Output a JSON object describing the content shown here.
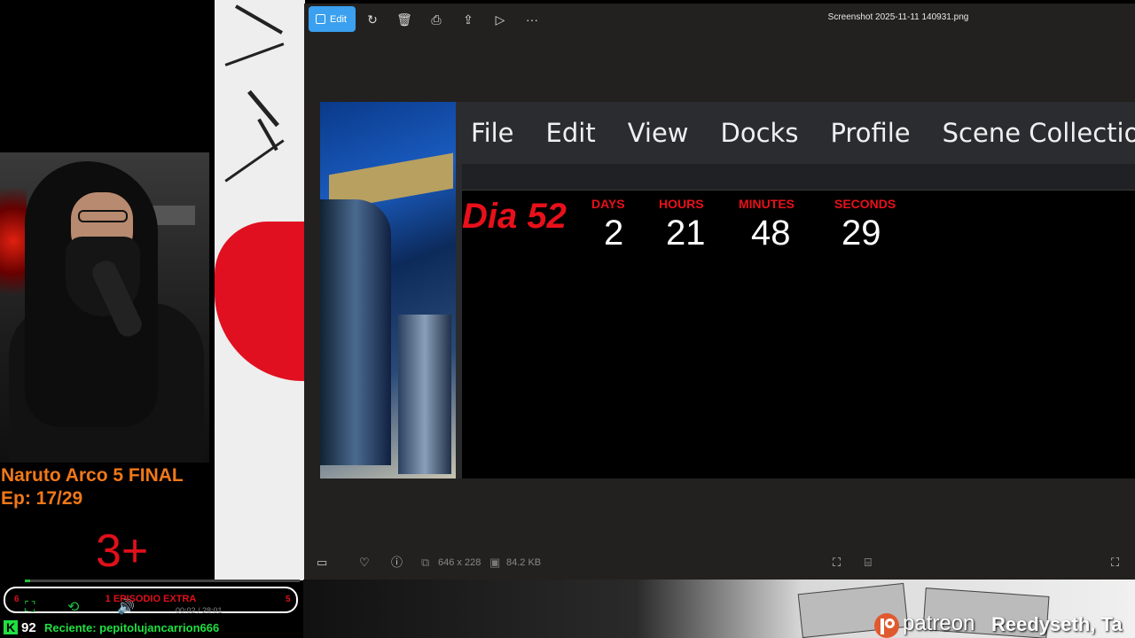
{
  "viewer": {
    "toolbar": {
      "edit_label": "Edit",
      "icons": [
        "edit-icon",
        "rotate-icon",
        "delete-icon",
        "print-icon",
        "share-icon",
        "slideshow-icon",
        "more-icon"
      ]
    },
    "file_name": "Screenshot 2025-11-11 140931.png",
    "image": {
      "menu": [
        "File",
        "Edit",
        "View",
        "Docks",
        "Profile",
        "Scene Collection"
      ],
      "countdown": {
        "title": "Dia 52",
        "units": [
          {
            "label": "DAYS",
            "value": "2"
          },
          {
            "label": "HOURS",
            "value": "21"
          },
          {
            "label": "MINUTES",
            "value": "48"
          },
          {
            "label": "SECONDS",
            "value": "29"
          }
        ]
      }
    },
    "status": {
      "dimensions": "646 x 228",
      "file_size": "84.2 KB"
    }
  },
  "overlay": {
    "series_title": "Naruto Arco 5 FINAL",
    "episode": "Ep: 17/29",
    "rating": "3+",
    "player": {
      "label": "1 EPISODIO EXTRA",
      "time": "00:02 / 28:01",
      "left_num": "6",
      "right_num": "5",
      "progress": 0.02
    },
    "kick_count": "92",
    "recent": "Reciente: pepitolujancarrion666",
    "patreon_word": "patreon",
    "patreon_names": "Reedyseth, Ta"
  },
  "colors": {
    "accent": "#3aa0ef",
    "overlay_orange": "#f07818",
    "overlay_red": "#e0101a",
    "kick_green": "#1fe040",
    "patreon": "#e05a30"
  }
}
